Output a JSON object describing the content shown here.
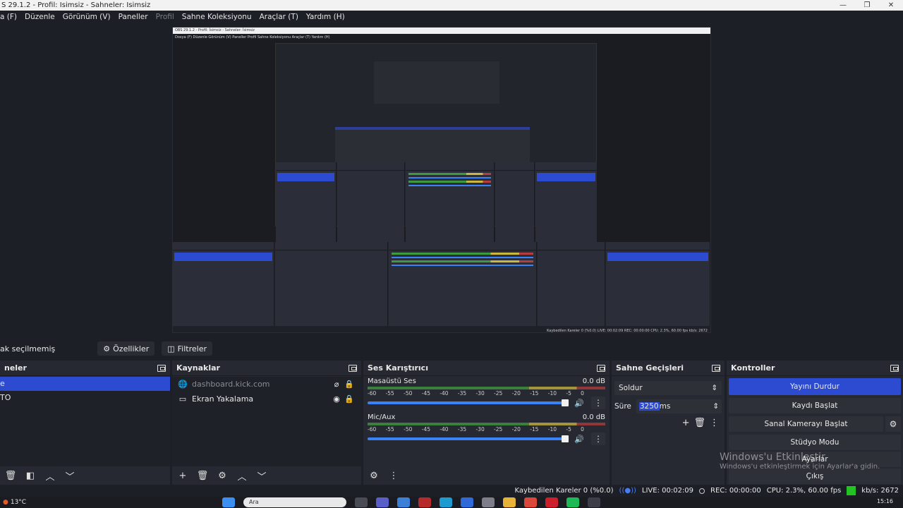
{
  "window": {
    "title": "S 29.1.2 - Profil: İsimsiz - Sahneler: İsimsiz",
    "min_glyph": "—",
    "max_glyph": "❐",
    "close_glyph": "✕"
  },
  "menu": {
    "items": [
      "a (F)",
      "Düzenle",
      "Görünüm (V)",
      "Paneller",
      "Profil",
      "Sahne Koleksiyonu",
      "Araçlar (T)",
      "Yardım (H)"
    ]
  },
  "preview": {
    "inner_title": "OBS 29.1.2 - Profil: İsimsiz - Sahneler: İsimsiz",
    "inner_menu": "Dosya (F)   Düzenle   Görünüm (V)   Paneller   Profil   Sahne Koleksiyonu   Araçlar (T)   Yardım (H)",
    "inner_status": "Kaybedilen Kareler 0 (%0.0)   LIVE: 00:02:09   REC: 00:00:00   CPU: 2.3%, 60.00 fps   kb/s: 2672",
    "inner_clock": "15:16"
  },
  "source_bar": {
    "no_source": "ak seçilmemiş",
    "properties_label": "Özellikler",
    "filters_label": "Filtreler"
  },
  "scenes": {
    "title": "neler",
    "items": [
      {
        "label": "e",
        "selected": true
      },
      {
        "label": "TO",
        "selected": false
      }
    ]
  },
  "sources": {
    "title": "Kaynaklar",
    "items": [
      {
        "label": "dashboard.kick.com",
        "icon": "globe-icon",
        "visible": false,
        "locked": true
      },
      {
        "label": "Ekran Yakalama",
        "icon": "monitor-icon",
        "visible": true,
        "locked": true
      }
    ]
  },
  "mixer": {
    "title": "Ses Karıştırıcı",
    "ticks": [
      "-60",
      "-55",
      "-50",
      "-45",
      "-40",
      "-35",
      "-30",
      "-25",
      "-20",
      "-15",
      "-10",
      "-5",
      "0"
    ],
    "channels": [
      {
        "name": "Masaüstü Ses",
        "db": "0.0 dB",
        "volume": 1.0
      },
      {
        "name": "Mic/Aux",
        "db": "0.0 dB",
        "volume": 1.0
      }
    ]
  },
  "transitions": {
    "title": "Sahne Geçişleri",
    "selected": "Soldur",
    "duration_label": "Süre",
    "duration_value": "3250",
    "duration_unit": "ms"
  },
  "controls": {
    "title": "Kontroller",
    "stop_stream": "Yayını Durdur",
    "start_recording": "Kaydı Başlat",
    "start_virtual_cam": "Sanal Kamerayı Başlat",
    "studio_mode": "Stüdyo Modu",
    "settings": "Ayarlar",
    "exit": "Çıkış"
  },
  "watermark": {
    "line1": "Windows'u Etkinleştir",
    "line2": "Windows'u etkinleştirmek için Ayarlar'a gidin."
  },
  "status": {
    "dropped": "Kaybedilen Kareler 0 (%0.0)",
    "live": "LIVE: 00:02:09",
    "rec": "REC: 00:00:00",
    "cpu": "CPU: 2.3%, 60.00 fps",
    "kbps": "kb/s: 2672",
    "health_color": "#22c322"
  },
  "taskbar": {
    "temperature": "13°C",
    "search_placeholder": "Ara",
    "clock": "15:16"
  },
  "colors": {
    "accent": "#2d4bd1",
    "background": "#1d1f26",
    "panel": "#272932"
  }
}
